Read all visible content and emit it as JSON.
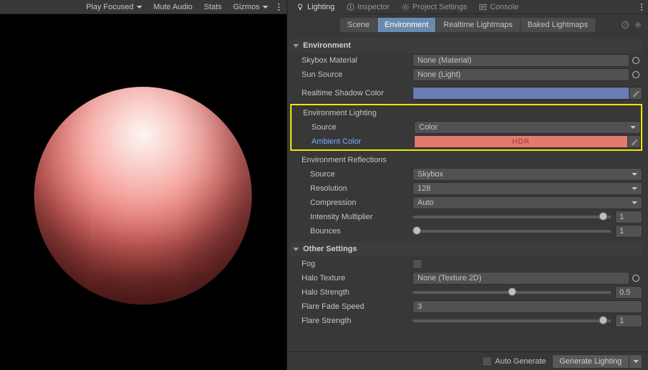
{
  "viewport": {
    "toolbar": {
      "play_focused": "Play Focused",
      "mute_audio": "Mute Audio",
      "stats": "Stats",
      "gizmos": "Gizmos"
    }
  },
  "tabs": {
    "lighting": "Lighting",
    "inspector": "Inspector",
    "project_settings": "Project Settings",
    "console": "Console"
  },
  "subtabs": {
    "scene": "Scene",
    "environment": "Environment",
    "realtime_lightmaps": "Realtime Lightmaps",
    "baked_lightmaps": "Baked Lightmaps"
  },
  "env": {
    "header": "Environment",
    "skybox_material_label": "Skybox Material",
    "skybox_material_value": "None (Material)",
    "sun_source_label": "Sun Source",
    "sun_source_value": "None (Light)",
    "realtime_shadow_label": "Realtime Shadow Color",
    "lighting_header": "Environment Lighting",
    "lighting_source_label": "Source",
    "lighting_source_value": "Color",
    "ambient_color_label": "Ambient Color",
    "ambient_color_badge": "HDR",
    "reflections_header": "Environment Reflections",
    "refl_source_label": "Source",
    "refl_source_value": "Skybox",
    "refl_resolution_label": "Resolution",
    "refl_resolution_value": "128",
    "refl_compression_label": "Compression",
    "refl_compression_value": "Auto",
    "refl_intensity_label": "Intensity Multiplier",
    "refl_intensity_value": "1",
    "refl_bounces_label": "Bounces",
    "refl_bounces_value": "1"
  },
  "other": {
    "header": "Other Settings",
    "fog_label": "Fog",
    "halo_texture_label": "Halo Texture",
    "halo_texture_value": "None (Texture 2D)",
    "halo_strength_label": "Halo Strength",
    "halo_strength_value": "0.5",
    "flare_fade_label": "Flare Fade Speed",
    "flare_fade_value": "3",
    "flare_strength_label": "Flare Strength",
    "flare_strength_value": "1"
  },
  "footer": {
    "auto_generate": "Auto Generate",
    "generate": "Generate Lighting"
  },
  "colors": {
    "shadow": "#6b7db5",
    "ambient": "#e47a6e"
  }
}
